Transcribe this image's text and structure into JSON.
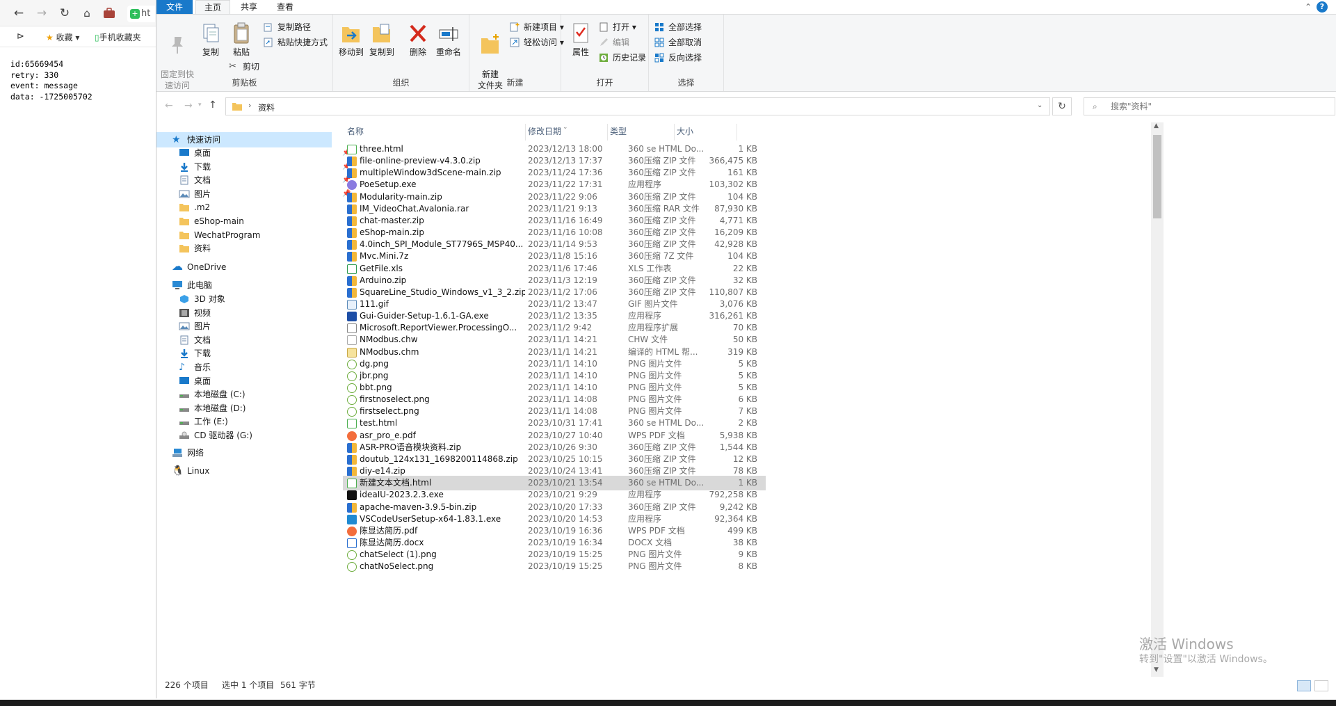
{
  "browser": {
    "tab_title": "ht",
    "bookmarks": {
      "favorites": "收藏",
      "mobile": "手机收藏夹"
    },
    "sse_text": "id:65669454\nretry: 330\nevent: message\ndata: -1725005702"
  },
  "ribbon": {
    "tabs": {
      "file": "文件",
      "home": "主页",
      "share": "共享",
      "view": "查看"
    },
    "help": "?",
    "clipboard": {
      "title": "剪贴板",
      "pin": "固定到快\n速访问",
      "copy": "复制",
      "paste": "粘贴",
      "copy_path": "复制路径",
      "paste_shortcut": "粘贴快捷方式",
      "cut": "剪切"
    },
    "organize": {
      "title": "组织",
      "move_to": "移动到",
      "copy_to": "复制到",
      "delete": "删除",
      "rename": "重命名"
    },
    "new": {
      "title": "新建",
      "new_folder": "新建\n文件夹",
      "new_item": "新建项目",
      "easy_access": "轻松访问"
    },
    "open": {
      "title": "打开",
      "properties": "属性",
      "open": "打开",
      "edit": "编辑",
      "history": "历史记录"
    },
    "select": {
      "title": "选择",
      "select_all": "全部选择",
      "select_none": "全部取消",
      "invert": "反向选择"
    }
  },
  "address": {
    "path": "资料",
    "search_placeholder": "搜索\"资料\""
  },
  "nav": {
    "quick_access": "快速访问",
    "quick_items": [
      "桌面",
      "下载",
      "文档",
      "图片",
      ".m2",
      "eShop-main",
      "WechatProgram",
      "资料"
    ],
    "onedrive": "OneDrive",
    "this_pc": "此电脑",
    "pc_items": [
      "3D 对象",
      "视频",
      "图片",
      "文档",
      "下载",
      "音乐",
      "桌面",
      "本地磁盘 (C:)",
      "本地磁盘 (D:)",
      "工作 (E:)",
      "CD 驱动器 (G:)"
    ],
    "network": "网络",
    "linux": "Linux"
  },
  "columns": {
    "name": "名称",
    "date": "修改日期",
    "type": "类型",
    "size": "大小"
  },
  "files": [
    {
      "name": "three.html",
      "date": "2023/12/13 18:00",
      "type": "360 se HTML Do...",
      "size": "1 KB",
      "icon": "html"
    },
    {
      "name": "file-online-preview-v4.3.0.zip",
      "date": "2023/12/13 17:37",
      "type": "360压缩 ZIP 文件",
      "size": "366,475 KB",
      "icon": "zip"
    },
    {
      "name": "multipleWindow3dScene-main.zip",
      "date": "2023/11/24 17:36",
      "type": "360压缩 ZIP 文件",
      "size": "161 KB",
      "icon": "zip"
    },
    {
      "name": "PoeSetup.exe",
      "date": "2023/11/22 17:31",
      "type": "应用程序",
      "size": "103,302 KB",
      "icon": "exe"
    },
    {
      "name": "Modularity-main.zip",
      "date": "2023/11/22 9:06",
      "type": "360压缩 ZIP 文件",
      "size": "104 KB",
      "icon": "zip"
    },
    {
      "name": "IM_VideoChat.Avalonia.rar",
      "date": "2023/11/21 9:13",
      "type": "360压缩 RAR 文件",
      "size": "87,930 KB",
      "icon": "zip"
    },
    {
      "name": "chat-master.zip",
      "date": "2023/11/16 16:49",
      "type": "360压缩 ZIP 文件",
      "size": "4,771 KB",
      "icon": "zip"
    },
    {
      "name": "eShop-main.zip",
      "date": "2023/11/16 10:08",
      "type": "360压缩 ZIP 文件",
      "size": "16,209 KB",
      "icon": "zip"
    },
    {
      "name": "4.0inch_SPI_Module_ST7796S_MSP40...",
      "date": "2023/11/14 9:53",
      "type": "360压缩 ZIP 文件",
      "size": "42,928 KB",
      "icon": "zip"
    },
    {
      "name": "Mvc.Mini.7z",
      "date": "2023/11/8 15:16",
      "type": "360压缩 7Z 文件",
      "size": "104 KB",
      "icon": "zip"
    },
    {
      "name": "GetFile.xls",
      "date": "2023/11/6 17:46",
      "type": "XLS 工作表",
      "size": "22 KB",
      "icon": "xls"
    },
    {
      "name": "Arduino.zip",
      "date": "2023/11/3 12:19",
      "type": "360压缩 ZIP 文件",
      "size": "32 KB",
      "icon": "zip"
    },
    {
      "name": "SquareLine_Studio_Windows_v1_3_2.zip",
      "date": "2023/11/2 17:06",
      "type": "360压缩 ZIP 文件",
      "size": "110,807 KB",
      "icon": "zip"
    },
    {
      "name": "111.gif",
      "date": "2023/11/2 13:47",
      "type": "GIF 图片文件",
      "size": "3,076 KB",
      "icon": "gif"
    },
    {
      "name": "Gui-Guider-Setup-1.6.1-GA.exe",
      "date": "2023/11/2 13:35",
      "type": "应用程序",
      "size": "316,261 KB",
      "icon": "exe2"
    },
    {
      "name": "Microsoft.ReportViewer.ProcessingO...",
      "date": "2023/11/2 9:42",
      "type": "应用程序扩展",
      "size": "70 KB",
      "icon": "dll"
    },
    {
      "name": "NModbus.chw",
      "date": "2023/11/1 14:21",
      "type": "CHW 文件",
      "size": "50 KB",
      "icon": "blank"
    },
    {
      "name": "NModbus.chm",
      "date": "2023/11/1 14:21",
      "type": "编译的 HTML 帮...",
      "size": "319 KB",
      "icon": "chm"
    },
    {
      "name": "dg.png",
      "date": "2023/11/1 14:10",
      "type": "PNG 图片文件",
      "size": "5 KB",
      "icon": "png"
    },
    {
      "name": "jbr.png",
      "date": "2023/11/1 14:10",
      "type": "PNG 图片文件",
      "size": "5 KB",
      "icon": "png"
    },
    {
      "name": "bbt.png",
      "date": "2023/11/1 14:10",
      "type": "PNG 图片文件",
      "size": "5 KB",
      "icon": "png"
    },
    {
      "name": "firstnoselect.png",
      "date": "2023/11/1 14:08",
      "type": "PNG 图片文件",
      "size": "6 KB",
      "icon": "png"
    },
    {
      "name": "firstselect.png",
      "date": "2023/11/1 14:08",
      "type": "PNG 图片文件",
      "size": "7 KB",
      "icon": "png"
    },
    {
      "name": "test.html",
      "date": "2023/10/31 17:41",
      "type": "360 se HTML Do...",
      "size": "2 KB",
      "icon": "html"
    },
    {
      "name": "asr_pro_e.pdf",
      "date": "2023/10/27 10:40",
      "type": "WPS PDF 文档",
      "size": "5,938 KB",
      "icon": "pdf"
    },
    {
      "name": "ASR-PRO语音模块资料.zip",
      "date": "2023/10/26 9:30",
      "type": "360压缩 ZIP 文件",
      "size": "1,544 KB",
      "icon": "zip"
    },
    {
      "name": "doutub_124x131_1698200114868.zip",
      "date": "2023/10/25 10:15",
      "type": "360压缩 ZIP 文件",
      "size": "12 KB",
      "icon": "zip"
    },
    {
      "name": "diy-e14.zip",
      "date": "2023/10/24 13:41",
      "type": "360压缩 ZIP 文件",
      "size": "78 KB",
      "icon": "zip"
    },
    {
      "name": "新建文本文档.html",
      "date": "2023/10/21 13:54",
      "type": "360 se HTML Do...",
      "size": "1 KB",
      "icon": "html",
      "selected": true
    },
    {
      "name": "ideaIU-2023.2.3.exe",
      "date": "2023/10/21 9:29",
      "type": "应用程序",
      "size": "792,258 KB",
      "icon": "idea"
    },
    {
      "name": "apache-maven-3.9.5-bin.zip",
      "date": "2023/10/20 17:33",
      "type": "360压缩 ZIP 文件",
      "size": "9,242 KB",
      "icon": "zip"
    },
    {
      "name": "VSCodeUserSetup-x64-1.83.1.exe",
      "date": "2023/10/20 14:53",
      "type": "应用程序",
      "size": "92,364 KB",
      "icon": "vscode"
    },
    {
      "name": "陈显达简历.pdf",
      "date": "2023/10/19 16:36",
      "type": "WPS PDF 文档",
      "size": "499 KB",
      "icon": "pdf"
    },
    {
      "name": "陈显达简历.docx",
      "date": "2023/10/19 16:34",
      "type": "DOCX 文档",
      "size": "38 KB",
      "icon": "doc"
    },
    {
      "name": "chatSelect (1).png",
      "date": "2023/10/19 15:25",
      "type": "PNG 图片文件",
      "size": "9 KB",
      "icon": "png"
    },
    {
      "name": "chatNoSelect.png",
      "date": "2023/10/19 15:25",
      "type": "PNG 图片文件",
      "size": "8 KB",
      "icon": "png"
    }
  ],
  "status": {
    "count": "226 个项目",
    "selected": "选中 1 个项目",
    "size": "561 字节"
  },
  "watermark": {
    "line1": "激活 Windows",
    "line2": "转到\"设置\"以激活 Windows。"
  },
  "colors": {
    "accent": "#1979ca",
    "selected_row": "#d9d9d9",
    "nav_selected": "#cce8ff"
  }
}
